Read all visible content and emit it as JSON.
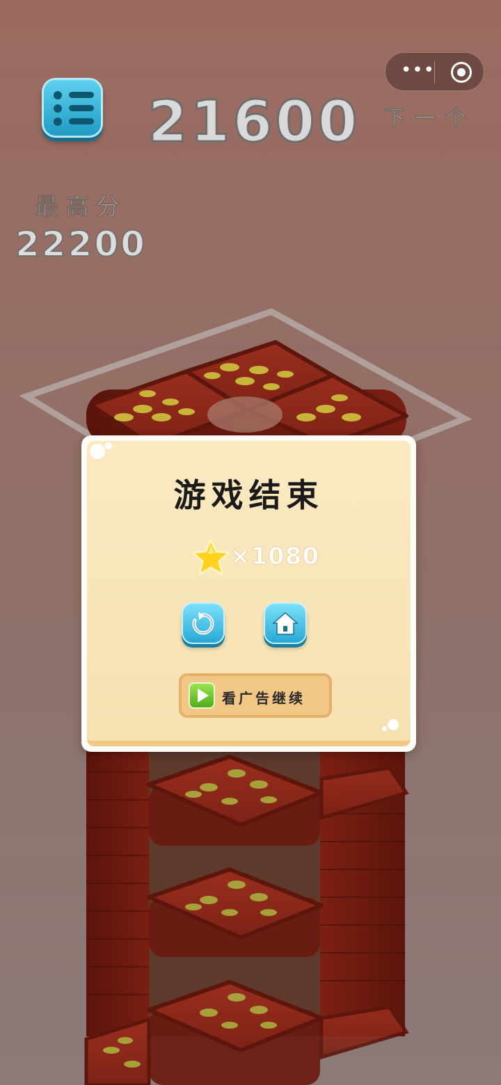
{
  "header": {
    "score": "21600",
    "next_label": "下一个",
    "best_label": "最高分",
    "best_value": "22200"
  },
  "capsule": {
    "more_glyph": "•••"
  },
  "dialog": {
    "title": "游戏结束",
    "star_count": "×1080",
    "ad_label": "看广告继续"
  },
  "icons": {
    "menu": "menu-list-icon",
    "more": "more-dots-icon",
    "close": "target-close-icon",
    "star": "star-icon",
    "restart": "restart-arrow-icon",
    "home": "home-icon",
    "play": "play-icon"
  },
  "colors": {
    "cake_side": "#6e1a10",
    "cake_top": "#8c2a1c",
    "seed": "#a8a03a",
    "dialog_bg": "#f6e1b0",
    "button_blue": "#27a9d6"
  }
}
